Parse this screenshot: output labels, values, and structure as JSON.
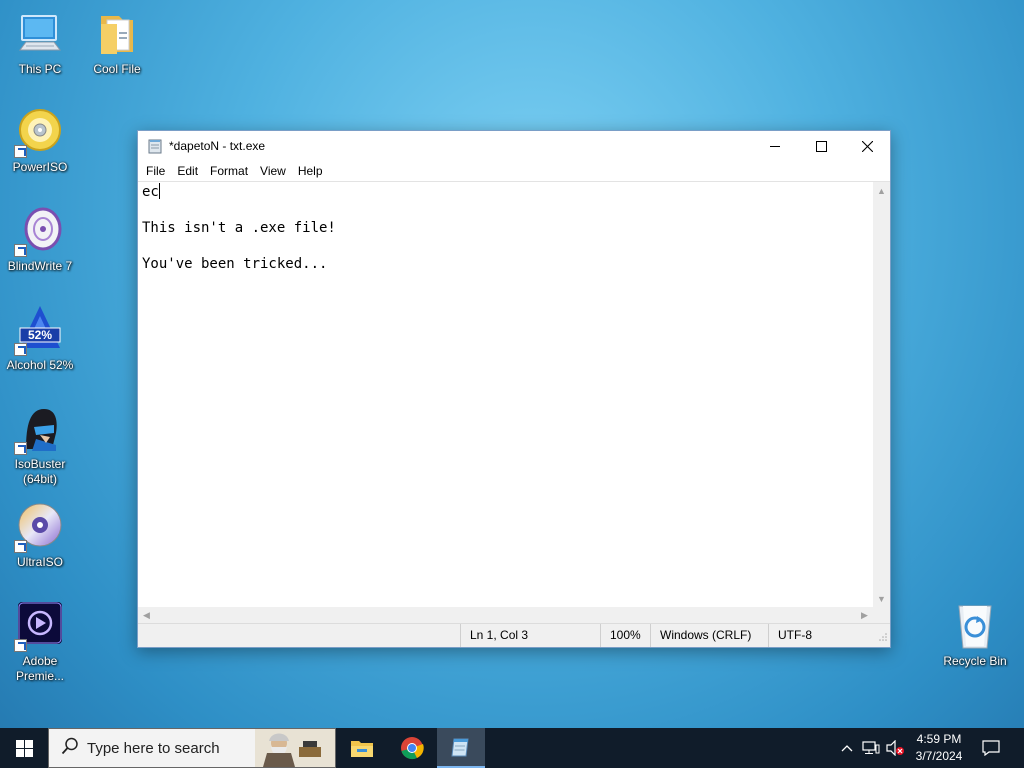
{
  "desktop": {
    "icons": [
      {
        "label": "This PC"
      },
      {
        "label": "Cool File"
      },
      {
        "label": "PowerISO"
      },
      {
        "label": "BlindWrite 7"
      },
      {
        "label": "Alcohol 52%",
        "badge": "52%"
      },
      {
        "label": "IsoBuster\n(64bit)"
      },
      {
        "label": "UltraISO"
      },
      {
        "label": "Adobe\nPremie..."
      },
      {
        "label": "Recycle Bin"
      }
    ]
  },
  "notepad": {
    "title": "*dapetoN - txt.exe",
    "menu": [
      "File",
      "Edit",
      "Format",
      "View",
      "Help"
    ],
    "lines": [
      "ec",
      "",
      "This isn't a .exe file!",
      "",
      "You've been tricked..."
    ],
    "status": {
      "position": "Ln 1, Col 3",
      "zoom": "100%",
      "line_ending": "Windows (CRLF)",
      "encoding": "UTF-8"
    }
  },
  "taskbar": {
    "search_placeholder": "Type here to search",
    "apps": [
      "file-explorer",
      "chrome",
      "notepad"
    ],
    "clock": {
      "time": "4:59 PM",
      "date": "3/7/2024"
    }
  },
  "colors": {
    "desktop_bg": "#4fb1e0",
    "taskbar_bg": "#101c2a"
  }
}
